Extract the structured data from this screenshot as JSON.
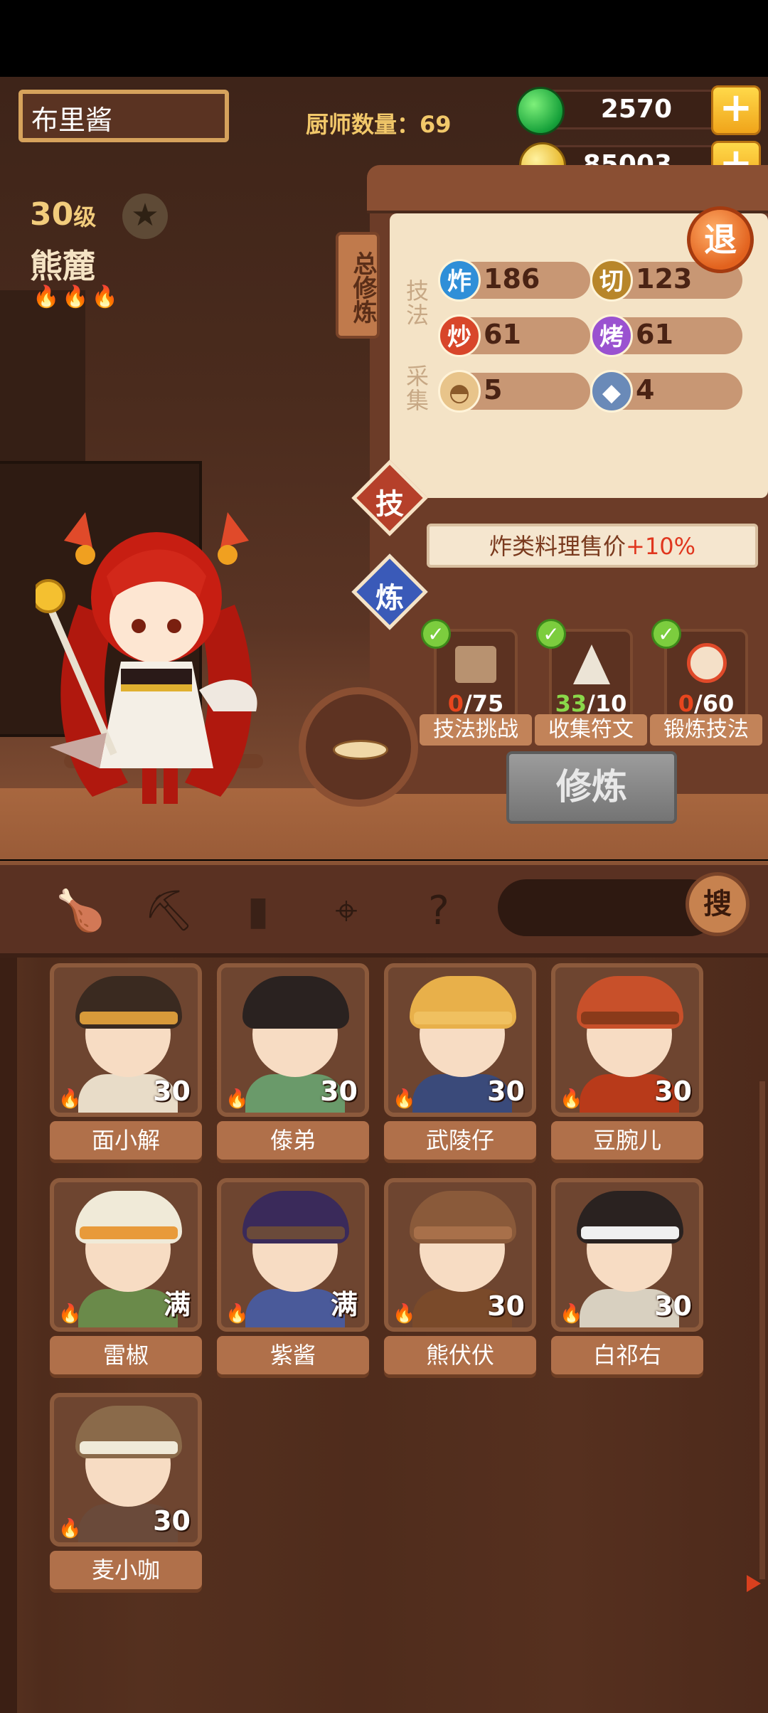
{
  "header": {
    "player_name": "布里酱",
    "chef_count_label": "厨师数量：",
    "chef_count": "69",
    "gems": "2570",
    "coins": "85003",
    "plus_icon": "plus-icon"
  },
  "character": {
    "level": "30",
    "level_unit": "级",
    "name": "熊麓",
    "flames": "🔥🔥🔥"
  },
  "board": {
    "tag": "总修炼",
    "exit": "退",
    "skill_label": "技法",
    "gather_label": "采集",
    "stats": [
      {
        "icon": "炸",
        "value": "186",
        "color": "#2f8fd8"
      },
      {
        "icon": "切",
        "value": "123",
        "color": "#b8862a"
      },
      {
        "icon": "炒",
        "value": "61",
        "color": "#d8462a"
      },
      {
        "icon": "烤",
        "value": "61",
        "color": "#9a52d0"
      },
      {
        "icon": "bread-icon",
        "value": "5",
        "color": "#e8c48a"
      },
      {
        "icon": "fish-icon",
        "value": "4",
        "color": "#6a8ab8"
      }
    ],
    "tab_skill": "技",
    "tab_refine": "炼",
    "bonus_text": "炸类料理售价",
    "bonus_value": "+10%",
    "tasks": [
      {
        "done": "0",
        "total": "/75",
        "label": "技法挑战",
        "icon": "scroll-icon"
      },
      {
        "done": "33",
        "total": "/10",
        "label": "收集符文",
        "icon": "rune-icon"
      },
      {
        "done": "0",
        "total": "/60",
        "label": "锻炼技法",
        "icon": "clock-icon"
      }
    ],
    "train_button": "修炼"
  },
  "nav": {
    "icons": [
      "drumstick-icon",
      "shovel-icon",
      "jar-icon",
      "location-pin-icon",
      "question-box-icon"
    ],
    "search_button": "搜",
    "search_placeholder": ""
  },
  "chefs": [
    {
      "name": "面小解",
      "level": "30",
      "hair": "#3a2a20",
      "band": "#d89a3a",
      "body": "#e8dcc8"
    },
    {
      "name": "傣弟",
      "level": "30",
      "hair": "#2a2220",
      "band": "#2a2220",
      "body": "#6a9a6a"
    },
    {
      "name": "武陵仔",
      "level": "30",
      "hair": "#e8b04a",
      "band": "#f0c060",
      "body": "#3a4a7a"
    },
    {
      "name": "豆腕儿",
      "level": "30",
      "hair": "#c8502a",
      "band": "#8a3a1a",
      "body": "#b83a1a"
    },
    {
      "name": "雷椒",
      "level": "满",
      "hair": "#f0ead8",
      "band": "#e89a3a",
      "body": "#6a8a4a"
    },
    {
      "name": "紫酱",
      "level": "满",
      "hair": "#3a2a5a",
      "band": "#6a4a3a",
      "body": "#4a5a9a"
    },
    {
      "name": "熊伏伏",
      "level": "30",
      "hair": "#8a5a3a",
      "band": "#a8704a",
      "body": "#7a4a2a"
    },
    {
      "name": "白祁右",
      "level": "30",
      "hair": "#2a2220",
      "band": "#f0f0f0",
      "body": "#d8d0c0"
    },
    {
      "name": "麦小咖",
      "level": "30",
      "hair": "#8a6a4a",
      "band": "#f0ead8",
      "body": "#6a4a3a"
    }
  ]
}
